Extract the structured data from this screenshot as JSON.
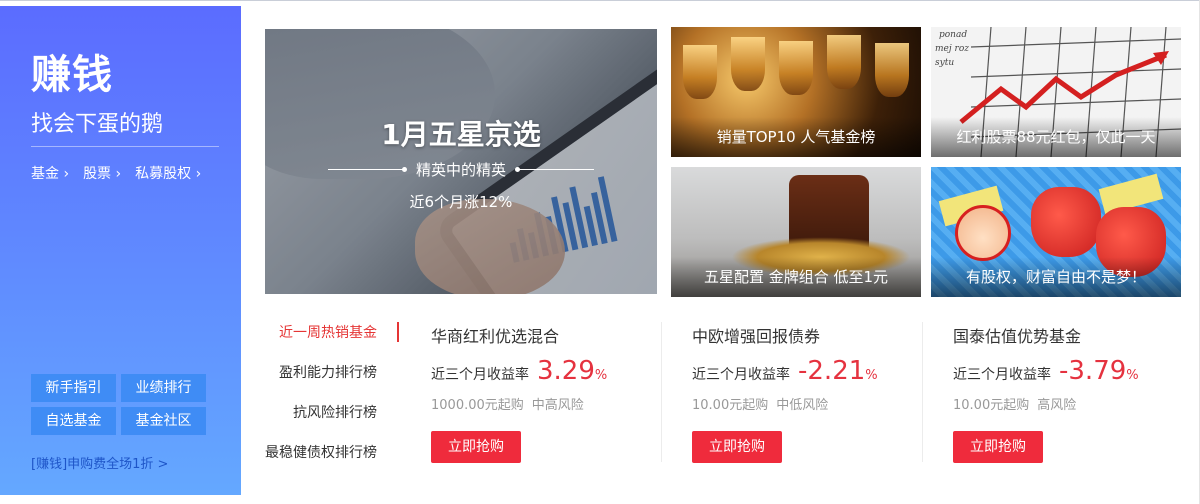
{
  "left_panel": {
    "title": "赚钱",
    "subtitle": "找会下蛋的鹅",
    "categories": [
      "基金 ›",
      "股票 ›",
      "私募股权 ›"
    ],
    "buttons": [
      "新手指引",
      "业绩排行",
      "自选基金",
      "基金社区"
    ],
    "promo": "[赚钱]申购费全场1折 >"
  },
  "main_banner": {
    "headline": "1月五星京选",
    "subheadline": "精英中的精英",
    "note": "近6个月涨12%"
  },
  "banners": [
    {
      "caption": "销量TOP10 人气基金榜"
    },
    {
      "caption": "红利股票88元红包，仅此一天"
    },
    {
      "caption": "五星配置 金牌组合 低至1元"
    },
    {
      "caption": "有股权，财富自由不是梦！"
    }
  ],
  "rank_tabs": [
    "近一周热销基金",
    "盈利能力排行榜",
    "抗风险排行榜",
    "最稳健债权排行榜"
  ],
  "funds": [
    {
      "name": "华商红利优选混合",
      "return_label": "近三个月收益率",
      "return_value": "3.29",
      "return_unit": "%",
      "min_purchase": "1000.00元起购",
      "risk": "中高风险",
      "buy_label": "立即抢购"
    },
    {
      "name": "中欧增强回报债券",
      "return_label": "近三个月收益率",
      "return_value": "-2.21",
      "return_unit": "%",
      "min_purchase": "10.00元起购",
      "risk": "中低风险",
      "buy_label": "立即抢购"
    },
    {
      "name": "国泰估值优势基金",
      "return_label": "近三个月收益率",
      "return_value": "-3.79",
      "return_unit": "%",
      "min_purchase": "10.00元起购",
      "risk": "高风险",
      "buy_label": "立即抢购"
    }
  ],
  "colors": {
    "accent_red": "#e5323f",
    "panel_blue": "#5b6cff",
    "button_blue": "#3f8cf5"
  }
}
